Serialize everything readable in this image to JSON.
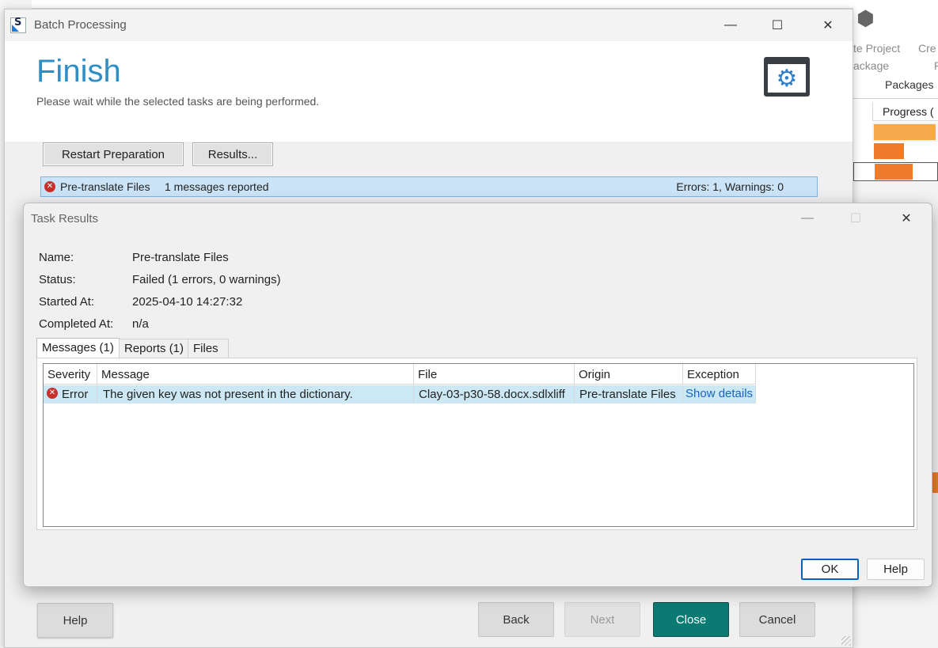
{
  "background": {
    "ribbon_line1": "te Project",
    "ribbon_line1b": "Cre",
    "ribbon_line2": "ackage",
    "ribbon_line2b": "P",
    "ribbon_group": "Packages",
    "grid_header": "Progress (",
    "colors": {
      "progress_light": "#f5a94a",
      "progress_dark": "#ee7b2a"
    }
  },
  "batch": {
    "window_title": "Batch Processing",
    "heading": "Finish",
    "subheading": "Please wait while the selected tasks are being performed.",
    "restart_label": "Restart Preparation",
    "results_label": "Results...",
    "task": {
      "name": "Pre-translate Files",
      "message": "1 messages reported",
      "counts": "Errors: 1, Warnings: 0"
    },
    "footer": {
      "help": "Help",
      "back": "Back",
      "next": "Next",
      "close": "Close",
      "cancel": "Cancel"
    },
    "accent": "#2e8ec5",
    "close_color": "#0b7a73"
  },
  "task_results": {
    "window_title": "Task Results",
    "info": {
      "name_label": "Name:",
      "name_value": "Pre-translate Files",
      "status_label": "Status:",
      "status_value": "Failed (1 errors, 0 warnings)",
      "started_label": "Started At:",
      "started_value": "2025-04-10 14:27:32",
      "completed_label": "Completed At:",
      "completed_value": "n/a"
    },
    "tabs": [
      "Messages (1)",
      "Reports (1)",
      "Files"
    ],
    "columns": [
      "Severity",
      "Message",
      "File",
      "Origin",
      "Exception"
    ],
    "rows": [
      {
        "severity": "Error",
        "message": "The given key was not present in the dictionary.",
        "file": "Clay-03-p30-58.docx.sdlxliff",
        "origin": "Pre-translate Files",
        "exception": "Show details"
      }
    ],
    "ok_label": "OK",
    "help_label": "Help",
    "error_color": "#c9302c"
  }
}
